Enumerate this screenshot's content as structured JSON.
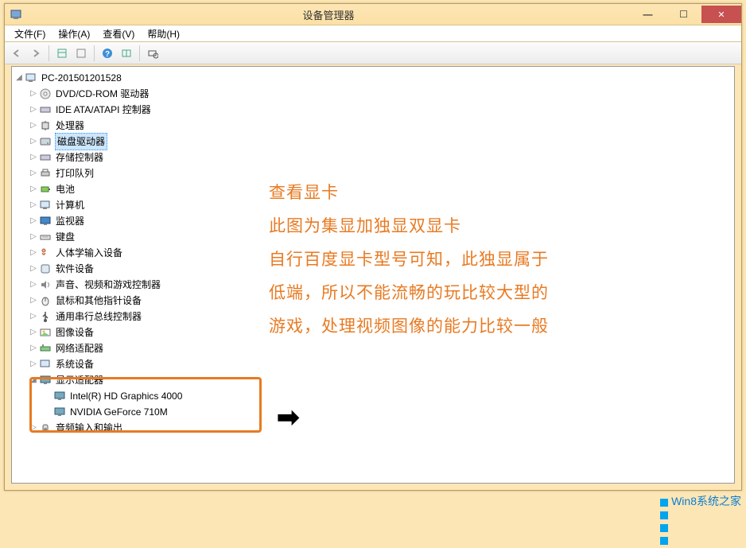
{
  "window": {
    "title": "设备管理器",
    "min": "—",
    "max": "☐",
    "close": "✕"
  },
  "menu": {
    "file": "文件(F)",
    "action": "操作(A)",
    "view": "查看(V)",
    "help": "帮助(H)"
  },
  "tree": {
    "root": "PC-201501201528",
    "items": [
      "DVD/CD-ROM 驱动器",
      "IDE ATA/ATAPI 控制器",
      "处理器",
      "磁盘驱动器",
      "存储控制器",
      "打印队列",
      "电池",
      "计算机",
      "监视器",
      "键盘",
      "人体学输入设备",
      "软件设备",
      "声音、视频和游戏控制器",
      "鼠标和其他指针设备",
      "通用串行总线控制器",
      "图像设备",
      "网络适配器",
      "系统设备",
      "显示适配器",
      "音频输入和输出"
    ],
    "display_adapters": [
      "Intel(R) HD Graphics 4000",
      "NVIDIA GeForce 710M"
    ]
  },
  "annotation": {
    "line1": "查看显卡",
    "line2": "此图为集显加独显双显卡",
    "line3": "自行百度显卡型号可知，此独显属于",
    "line4": "低端，所以不能流畅的玩比较大型的",
    "line5": "游戏，处理视频图像的能力比较一般"
  },
  "watermark": "Win8系统之家",
  "colors": {
    "accent": "#e87a22",
    "titlebar_bg": "#fde6b5",
    "close_btn": "#c75050",
    "selection": "#cde6fb"
  }
}
